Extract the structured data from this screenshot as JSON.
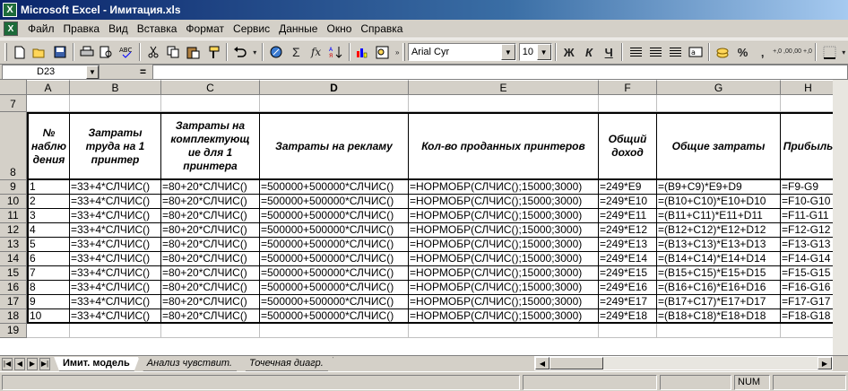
{
  "window": {
    "title": "Microsoft Excel - Имитация.xls"
  },
  "menu": [
    {
      "label": "Файл",
      "key": "Ф"
    },
    {
      "label": "Правка",
      "key": "П"
    },
    {
      "label": "Вид",
      "key": "В"
    },
    {
      "label": "Вставка",
      "key": "а"
    },
    {
      "label": "Формат",
      "key": "о"
    },
    {
      "label": "Сервис",
      "key": "С"
    },
    {
      "label": "Данные",
      "key": "Д"
    },
    {
      "label": "Окно",
      "key": "О"
    },
    {
      "label": "Справка",
      "key": "С"
    }
  ],
  "toolbar": {
    "font_name": "Arial Cyr",
    "font_size": "10",
    "bold_label": "Ж",
    "italic_label": "К",
    "underline_label": "Ч",
    "sum_label": "Σ",
    "fx_label": "fx",
    "percent_label": "%",
    "comma_label": ",",
    "inc_decimal_label": "+,0 ,00",
    "dec_decimal_label": ",00 +,0"
  },
  "formula_bar": {
    "name_box": "D23",
    "equals": "=",
    "value": ""
  },
  "columns": [
    "A",
    "B",
    "C",
    "D",
    "E",
    "F",
    "G",
    "H"
  ],
  "selected_column": "D",
  "row_headers": [
    "7",
    "8",
    "9",
    "10",
    "11",
    "12",
    "13",
    "14",
    "15",
    "16",
    "17",
    "18",
    "19"
  ],
  "header_row": [
    "№ наблюдения",
    "Затраты труда на 1 принтер",
    "Затраты на комплектующие для 1 принтера",
    "Затраты на рекламу",
    "Кол-во проданных принтеров",
    "Общий доход",
    "Общие затраты",
    "Прибыль"
  ],
  "header_row_lines": [
    [
      "№",
      "наблю",
      "дения"
    ],
    [
      "Затраты",
      "труда на 1",
      "принтер"
    ],
    [
      "Затраты на",
      "комплектующ",
      "ие для 1",
      "принтера"
    ],
    [
      "Затраты на рекламу"
    ],
    [
      "Кол-во проданных принтеров"
    ],
    [
      "Общий",
      "доход"
    ],
    [
      "Общие затраты"
    ],
    [
      "Прибыль"
    ]
  ],
  "data_rows": [
    [
      "1",
      "=33+4*СЛЧИС()",
      "=80+20*СЛЧИС()",
      "=500000+500000*СЛЧИС()",
      "=НОРМОБР(СЛЧИС();15000;3000)",
      "=249*E9",
      "=(B9+C9)*E9+D9",
      "=F9-G9"
    ],
    [
      "2",
      "=33+4*СЛЧИС()",
      "=80+20*СЛЧИС()",
      "=500000+500000*СЛЧИС()",
      "=НОРМОБР(СЛЧИС();15000;3000)",
      "=249*E10",
      "=(B10+C10)*E10+D10",
      "=F10-G10"
    ],
    [
      "3",
      "=33+4*СЛЧИС()",
      "=80+20*СЛЧИС()",
      "=500000+500000*СЛЧИС()",
      "=НОРМОБР(СЛЧИС();15000;3000)",
      "=249*E11",
      "=(B11+C11)*E11+D11",
      "=F11-G11"
    ],
    [
      "4",
      "=33+4*СЛЧИС()",
      "=80+20*СЛЧИС()",
      "=500000+500000*СЛЧИС()",
      "=НОРМОБР(СЛЧИС();15000;3000)",
      "=249*E12",
      "=(B12+C12)*E12+D12",
      "=F12-G12"
    ],
    [
      "5",
      "=33+4*СЛЧИС()",
      "=80+20*СЛЧИС()",
      "=500000+500000*СЛЧИС()",
      "=НОРМОБР(СЛЧИС();15000;3000)",
      "=249*E13",
      "=(B13+C13)*E13+D13",
      "=F13-G13"
    ],
    [
      "6",
      "=33+4*СЛЧИС()",
      "=80+20*СЛЧИС()",
      "=500000+500000*СЛЧИС()",
      "=НОРМОБР(СЛЧИС();15000;3000)",
      "=249*E14",
      "=(B14+C14)*E14+D14",
      "=F14-G14"
    ],
    [
      "7",
      "=33+4*СЛЧИС()",
      "=80+20*СЛЧИС()",
      "=500000+500000*СЛЧИС()",
      "=НОРМОБР(СЛЧИС();15000;3000)",
      "=249*E15",
      "=(B15+C15)*E15+D15",
      "=F15-G15"
    ],
    [
      "8",
      "=33+4*СЛЧИС()",
      "=80+20*СЛЧИС()",
      "=500000+500000*СЛЧИС()",
      "=НОРМОБР(СЛЧИС();15000;3000)",
      "=249*E16",
      "=(B16+C16)*E16+D16",
      "=F16-G16"
    ],
    [
      "9",
      "=33+4*СЛЧИС()",
      "=80+20*СЛЧИС()",
      "=500000+500000*СЛЧИС()",
      "=НОРМОБР(СЛЧИС();15000;3000)",
      "=249*E17",
      "=(B17+C17)*E17+D17",
      "=F17-G17"
    ],
    [
      "10",
      "=33+4*СЛЧИС()",
      "=80+20*СЛЧИС()",
      "=500000+500000*СЛЧИС()",
      "=НОРМОБР(СЛЧИС();15000;3000)",
      "=249*E18",
      "=(B18+C18)*E18+D18",
      "=F18-G18"
    ]
  ],
  "sheet_tabs": [
    {
      "label": "Имит. модель",
      "active": true
    },
    {
      "label": "Анализ чувствит.",
      "active": false
    },
    {
      "label": "Точечная диагр.",
      "active": false
    }
  ],
  "status": {
    "num": "NUM"
  },
  "icons": [
    "excel-app-icon",
    "new-icon",
    "open-icon",
    "save-icon",
    "print-icon",
    "print-preview-icon",
    "spelling-icon",
    "cut-icon",
    "copy-icon",
    "paste-icon",
    "format-painter-icon",
    "undo-icon",
    "hyperlink-icon",
    "sort-icon",
    "chart-wizard-icon",
    "drawing-icon",
    "align-left-icon",
    "align-center-icon",
    "align-right-icon",
    "merge-icon",
    "currency-icon",
    "borders-icon"
  ],
  "colors": {
    "title_start": "#0a246a",
    "title_end": "#a6caf0",
    "chrome": "#d4d0c8"
  }
}
